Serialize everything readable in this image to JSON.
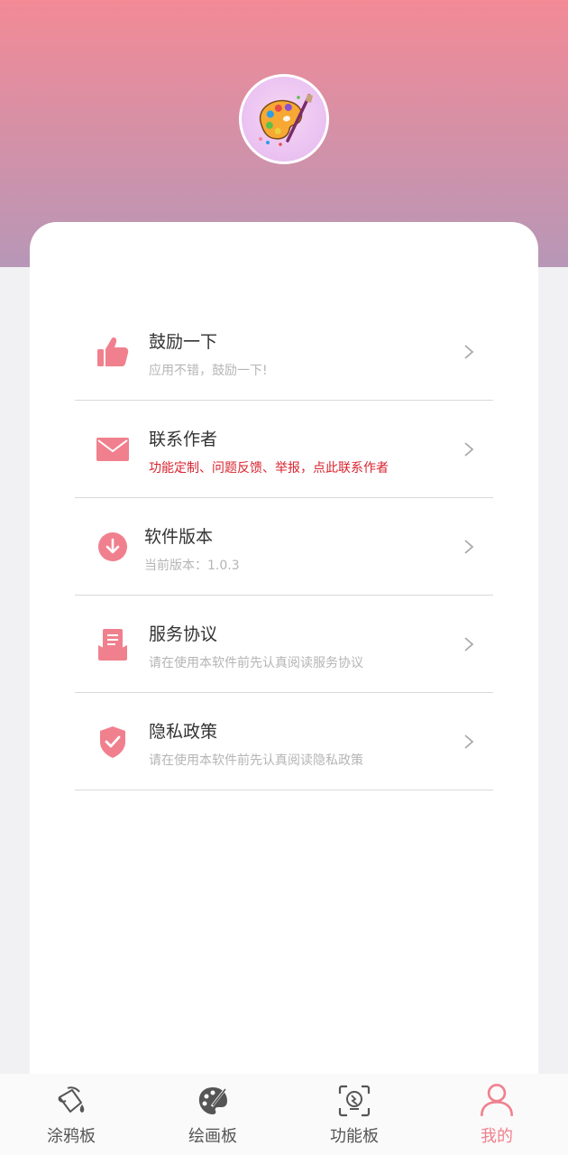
{
  "colors": {
    "accent": "#f0808e",
    "header_top": "#f38a96",
    "header_bottom": "#b797b7",
    "warning_text": "#d8242f"
  },
  "profile": {
    "avatar_icon": "palette-paintbrush-icon"
  },
  "menu": [
    {
      "icon": "thumbs-up-icon",
      "title": "鼓励一下",
      "subtitle": "应用不错，鼓励一下!"
    },
    {
      "icon": "envelope-icon",
      "title": "联系作者",
      "subtitle": "功能定制、问题反馈、举报，点此联系作者"
    },
    {
      "icon": "download-icon",
      "title": "软件版本",
      "subtitle": "当前版本：1.0.3"
    },
    {
      "icon": "document-icon",
      "title": "服务协议",
      "subtitle": "请在使用本软件前先认真阅读服务协议"
    },
    {
      "icon": "shield-check-icon",
      "title": "隐私政策",
      "subtitle": "请在使用本软件前先认真阅读隐私政策"
    }
  ],
  "tabbar": [
    {
      "icon": "paint-bucket-icon",
      "label": "涂鸦板"
    },
    {
      "icon": "palette-icon",
      "label": "绘画板"
    },
    {
      "icon": "face-scan-icon",
      "label": "功能板"
    },
    {
      "icon": "person-icon",
      "label": "我的",
      "active": true
    }
  ]
}
